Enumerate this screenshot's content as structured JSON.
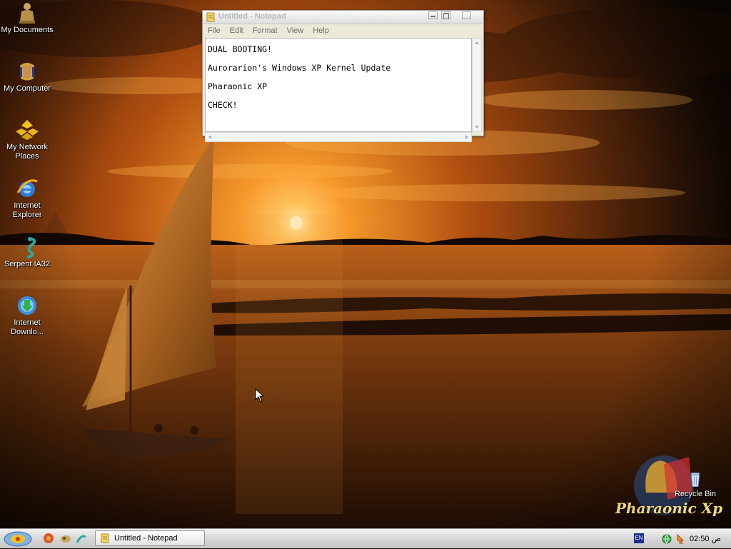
{
  "desktop": {
    "icons": [
      {
        "label": "My Documents"
      },
      {
        "label": "My Computer"
      },
      {
        "label": "My Network Places"
      },
      {
        "label": "Internet Explorer"
      },
      {
        "label": "Serpent IA32"
      },
      {
        "label": "Internet Downlo..."
      },
      {
        "label": "Recycle Bin"
      }
    ],
    "brand_logo_text": "Pharaonic Xp"
  },
  "notepad": {
    "title": "Untitled - Notepad",
    "menu": [
      "File",
      "Edit",
      "Format",
      "View",
      "Help"
    ],
    "lines": [
      "DUAL BOOTING!",
      "Aurorarion's Windows XP Kernel Update",
      "Pharaonic XP",
      "CHECK!"
    ]
  },
  "taskbar": {
    "task_label": "Untitled - Notepad",
    "language": "EN",
    "clock": "02:50 ص"
  },
  "colors": {
    "sky_orange": "#e0791f",
    "sun": "#ffd36b",
    "water": "#7a3a0c",
    "taskbar": "#d6d6d6"
  }
}
